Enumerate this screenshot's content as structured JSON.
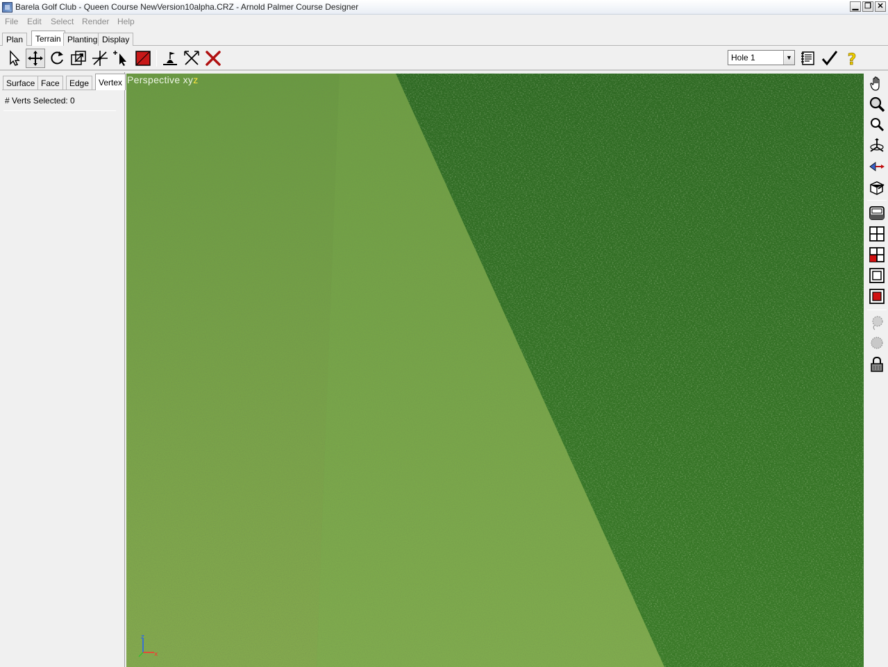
{
  "window": {
    "title": "Barela Golf Club - Queen Course NewVersion10alpha.CRZ - Arnold Palmer Course Designer"
  },
  "menu": [
    "File",
    "Edit",
    "Select",
    "Render",
    "Help"
  ],
  "tabs": [
    "Plan",
    "Terrain",
    "Planting",
    "Display"
  ],
  "active_tab": "Terrain",
  "toolbar": {
    "tools": [
      "select-arrow-icon",
      "move-icon",
      "rotate-icon",
      "scale-icon",
      "vertex-split-icon",
      "pointer-add-icon",
      "red-fill-icon",
      "flag-smooth-icon",
      "cross-cut-icon",
      "delete-x-icon"
    ],
    "hole_select": {
      "value": "Hole 1"
    },
    "right_tools": [
      "notes-icon",
      "checkmark-icon",
      "help-question-icon"
    ]
  },
  "left_panel": {
    "subtabs": [
      "Surface",
      "Face",
      "Edge",
      "Vertex"
    ],
    "active_subtab": "Vertex",
    "verts_selected_label": "# Verts Selected: 0"
  },
  "viewport": {
    "label_prefix": "Perspective  xy",
    "label_axis": "z",
    "axis_labels": {
      "x": "x",
      "y": "y",
      "z": "z"
    }
  },
  "right_toolbar": [
    "pan-hand-icon",
    "zoom-magnifier-icon",
    "zoom-small-icon",
    "orbit-axis-icon",
    "fly-arrow-icon",
    "camera-view-icon",
    "single-view-icon",
    "quad-view-icon",
    "quad-red-view-icon",
    "maximize-view-icon",
    "maximize-red-view-icon",
    "lasso-icon",
    "lasso-dotted-icon",
    "lock-icon"
  ],
  "colors": {
    "rough": "#7aa648",
    "fairway_stripe": "#78a84a",
    "deep_rough": "#2f6a22",
    "label": "#eef6e6",
    "label_axis": "#ffe640"
  }
}
